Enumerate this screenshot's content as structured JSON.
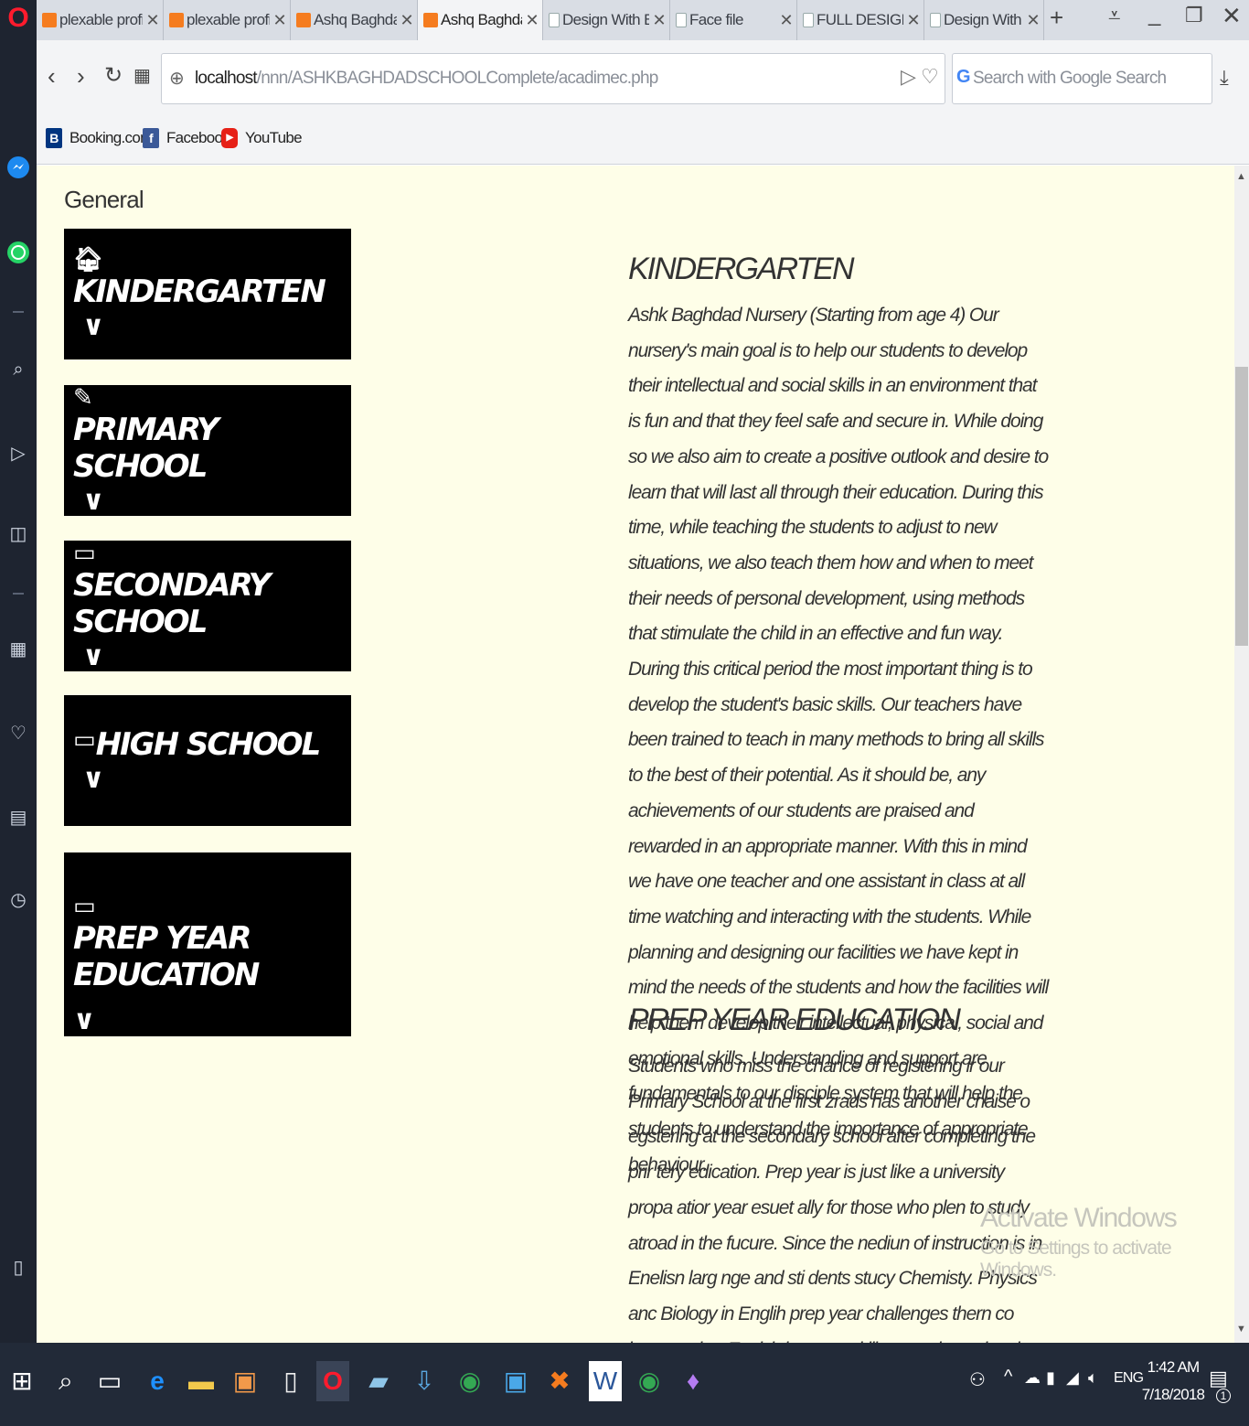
{
  "tabs": [
    {
      "label": "plexable profile",
      "icon": "xampp-icon"
    },
    {
      "label": "plexable profile",
      "icon": "xampp-icon"
    },
    {
      "label": "Ashq Baghdad",
      "icon": "xampp-icon"
    },
    {
      "label": "Ashq Baghdad",
      "icon": "xampp-icon",
      "active": true
    },
    {
      "label": "Design With Bo",
      "icon": "document-icon"
    },
    {
      "label": "Face file",
      "icon": "document-icon"
    },
    {
      "label": "FULL DESIGN",
      "icon": "document-icon"
    },
    {
      "label": "Design With Bo",
      "icon": "document-icon"
    }
  ],
  "address": {
    "host": "localhost",
    "path": "/nnn/ASHKBAGHDADSCHOOLComplete/acadimec.php",
    "search_placeholder": "Search with Google Search"
  },
  "bookmarks": [
    {
      "label": "Booking.com",
      "icon": "booking-icon",
      "color": "#003580",
      "glyph": "B"
    },
    {
      "label": "Facebook",
      "icon": "facebook-icon",
      "color": "#3b5998",
      "glyph": "f"
    },
    {
      "label": "YouTube",
      "icon": "youtube-icon",
      "color": "#e62117",
      "glyph": "▶"
    }
  ],
  "page": {
    "section_title": "General",
    "menu": [
      {
        "label": "KINDERGARTEN",
        "icon": "home-icon"
      },
      {
        "label": "PRIMARY SCHOOL",
        "icon": "edit-icon"
      },
      {
        "label": "SECONDARY SCHOOL",
        "icon": "monitor-icon"
      },
      {
        "label": "HIGH SCHOOL",
        "icon": "monitor-icon"
      },
      {
        "label": "PREP YEAR EDUCATION",
        "icon": "monitor-icon"
      }
    ],
    "kindergarten": {
      "heading": "KINDERGARTEN",
      "body": "Ashk Baghdad Nursery (Starting from age 4) Our nursery's main goal is to help our students to develop their intellectual and social skills in an environment that is fun and that they feel safe and secure in. While doing so we also aim to create a positive outlook and desire to learn that will last all through their education. During this time, while teaching the students to adjust to new situations, we also teach them how and when to meet their needs of personal development, using methods that stimulate the child in an effective and fun way. During this critical period the most important thing is to develop the student's basic skills. Our teachers have been trained to teach in many methods to bring all skills to the best of their potential. As it should be, any achievements of our students are praised and rewarded in an appropriate manner. With this in mind we have one teacher and one assistant in class at all time watching and interacting with the students. While planning and designing our facilities we have kept in mind the needs of the students and how the facilities will help them develop their intellectual, physical, social and emotional skills. Understanding and support are fundamentals to our disciple system that will help the students to understand the importance of appropriate behaviour."
    },
    "prep": {
      "heading": "PREP YEAR EDUCATION",
      "body": "Students who miss the chance of registering ir our Primary School at the first zrads has another chaise o egstering at the secondary school after completing the prir tery edication. Prep year is just like a university propa atior year esuet ally for those who plen to study atroad in the fucure. Since the nediun of instruction is in Enelisn larg nge and sti dents stucy Chemisty. Physics anc Biology in Englih prep year challenges thern co improve ther Engish languae skill a at an interationel levcl bctore sarting tho frs: grade at Semiary Schoal Why prep year?"
    }
  },
  "watermark": {
    "line1": "Activate Windows",
    "line2": "Go to Settings to activate Windows."
  },
  "taskbar": {
    "language": "ENG",
    "time": "1:42 AM",
    "date": "7/18/2018",
    "notification_count": "1"
  }
}
